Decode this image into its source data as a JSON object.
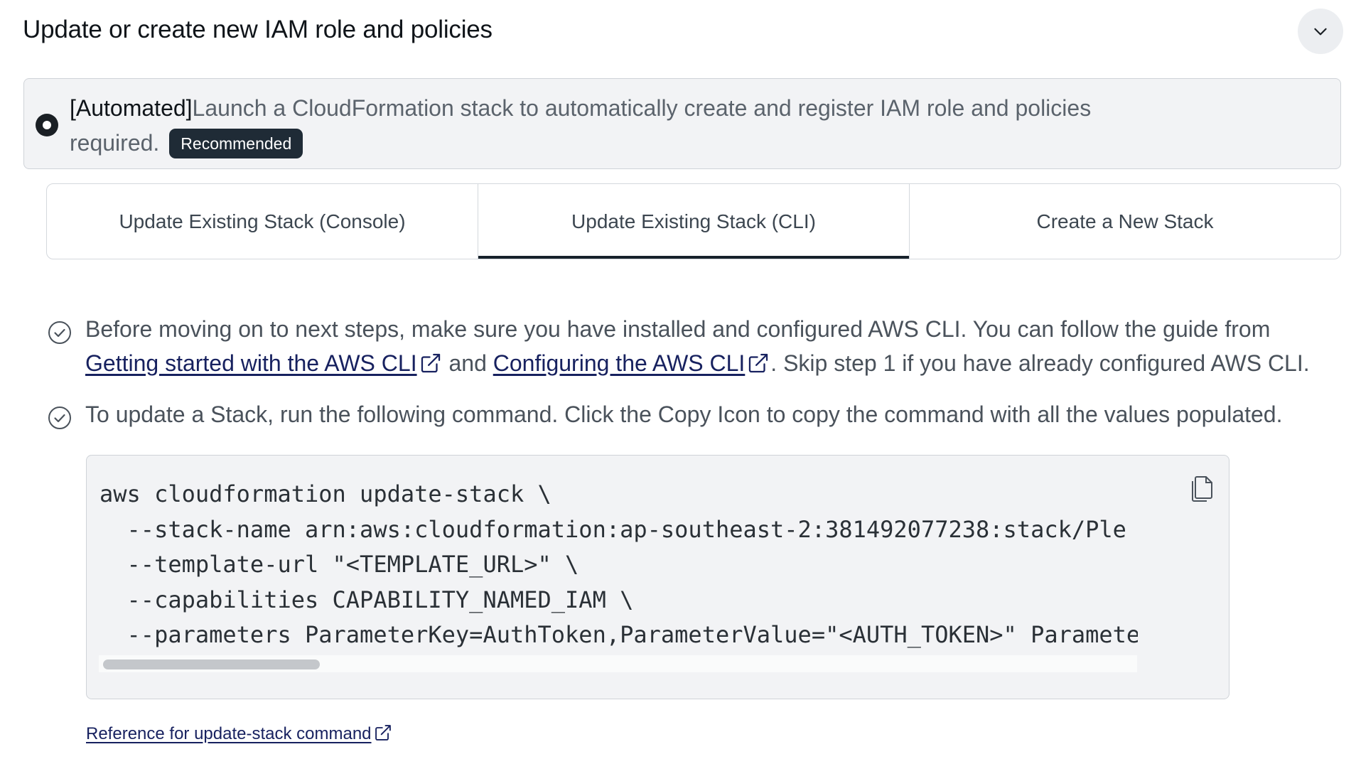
{
  "header": {
    "title": "Update or create new IAM role and policies",
    "collapse_icon": "chevron-down-icon"
  },
  "option": {
    "selected": true,
    "prefix": "[Automated]",
    "text": "Launch a CloudFormation stack to automatically create and register IAM role and policies required.",
    "badge": "Recommended"
  },
  "tabs": [
    {
      "label": "Update Existing Stack (Console)",
      "active": false
    },
    {
      "label": "Update Existing Stack (CLI)",
      "active": true
    },
    {
      "label": "Create a New Stack",
      "active": false
    }
  ],
  "steps": {
    "step1": {
      "text_before": "Before moving on to next steps, make sure you have installed and configured AWS CLI. You can follow the guide from",
      "link1": "Getting started with the AWS CLI",
      "between": "and",
      "link2": "Configuring the AWS CLI",
      "text_after": ". Skip step 1 if you have already configured AWS CLI."
    },
    "step2": {
      "text": "To update a Stack, run the following command. Click the Copy Icon to copy the command with all the values populated."
    }
  },
  "code": {
    "lines": [
      "aws cloudformation update-stack \\",
      "  --stack-name arn:aws:cloudformation:ap-southeast-2:381492077238:stack/Ple",
      "  --template-url \"<TEMPLATE_URL>\" \\",
      "  --capabilities CAPABILITY_NAMED_IAM \\",
      "  --parameters ParameterKey=AuthToken,ParameterValue=\"<AUTH_TOKEN>\" Paramete"
    ],
    "copy_icon": "copy-icon"
  },
  "reference": {
    "link": "Reference for update-stack command"
  },
  "colors": {
    "accent_dark": "#17212b",
    "link": "#17215f",
    "badge_bg": "#1f2b36",
    "panel_bg": "#f2f3f5"
  }
}
